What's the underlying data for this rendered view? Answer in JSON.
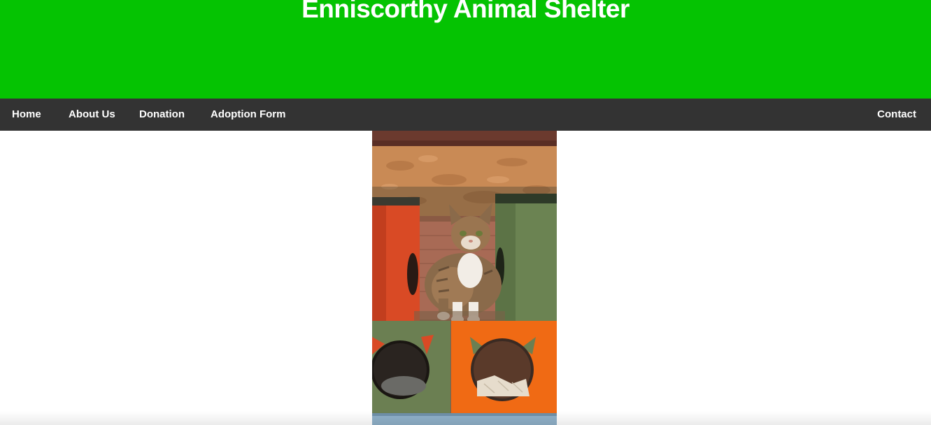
{
  "header": {
    "title": "Enniscorthy Animal Shelter",
    "background_color": "#05c302"
  },
  "nav": {
    "background_color": "#333333",
    "items": [
      {
        "label": "Home"
      },
      {
        "label": "About Us"
      },
      {
        "label": "Donation"
      },
      {
        "label": "Adoption Form"
      }
    ],
    "contact_label": "Contact"
  },
  "main": {
    "image_subject": "tabby cat standing inside wooden cat houses (red, green, orange)"
  }
}
